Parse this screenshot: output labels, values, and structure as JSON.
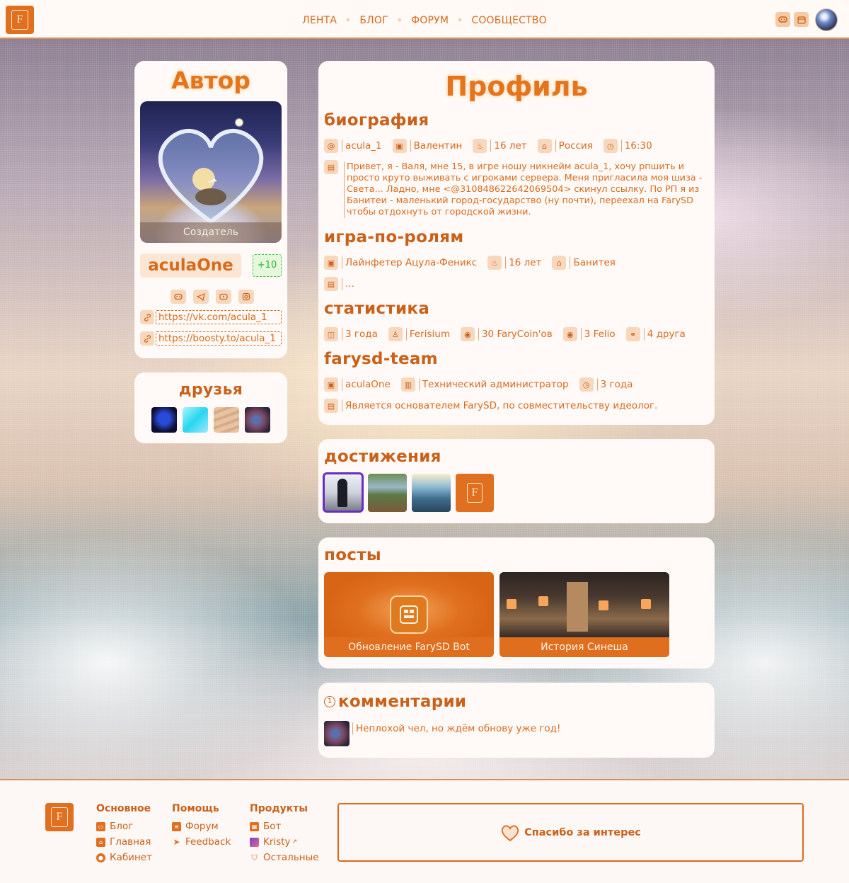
{
  "header": {
    "nav": [
      "ЛЕНТА",
      "БЛОГ",
      "ФОРУМ",
      "СООБЩЕСТВО"
    ]
  },
  "author": {
    "title": "Автор",
    "role": "Создатель",
    "username": "aculaOne",
    "rating": "+10",
    "links": [
      "https://vk.com/acula_1",
      "https://boosty.to/acula_1"
    ]
  },
  "friends": {
    "title": "друзья"
  },
  "profile": {
    "title": "Профиль",
    "bio": {
      "title": "биография",
      "nickname": "acula_1",
      "name": "Валентин",
      "age": "16 лет",
      "country": "Россия",
      "time": "16:30",
      "text": "Привет, я - Валя, мне 15, в игре ношу никнейм acula_1, хочу рпшить и просто круто выживать с игроками сервера. Меня пригласила моя шиза - Света... Ладно, мне <@310848622642069504> скинул ссылку. По РП я из Банитеи - маленький город-государство (ну почти), переехал на FarySD чтобы отдохнуть от городской жизни."
    },
    "rp": {
      "title": "игра-по-ролям",
      "character": "Лайнфетер Ацула-Феникс",
      "age": "16 лет",
      "origin": "Банитея",
      "note": "..."
    },
    "stats": {
      "title": "статистика",
      "playtime": "3 года",
      "server": "Ferisium",
      "coins": "30 FaryCoin'ов",
      "felio": "3 Felio",
      "friends": "4 друга"
    },
    "team": {
      "title": "farysd-team",
      "nick": "aculaOne",
      "position": "Технический администратор",
      "tenure": "3 года",
      "note": "Является основателем FarySD, по совместительству идеолог."
    }
  },
  "achievements": {
    "title": "достижения"
  },
  "posts": {
    "title": "посты",
    "items": [
      {
        "title": "Обновление FarySD Bot"
      },
      {
        "title": "История Синеша"
      }
    ]
  },
  "comments": {
    "count": "1",
    "title": "комментарии",
    "items": [
      {
        "text": "Неплохой чел, но ждём обнову уже год!"
      }
    ]
  },
  "footer": {
    "logo": "F",
    "cols": [
      {
        "title": "Основное",
        "links": [
          "Блог",
          "Главная",
          "Кабинет"
        ]
      },
      {
        "title": "Помощь",
        "links": [
          "Форум",
          "Feedback"
        ]
      },
      {
        "title": "Продукты",
        "links": [
          "Бот",
          "Kristy",
          "Остальные"
        ]
      }
    ],
    "thanks": "Спасибо за интерес"
  },
  "colors": {
    "accent": "#e07020",
    "text": "#d86a1c",
    "card": "#fffaf7",
    "rating_green": "#3cc43c"
  },
  "icons": {
    "logo": "farysd-logo-icon",
    "header_buttons": [
      "discord-icon",
      "calendar-icon"
    ],
    "socials": [
      "discord-icon",
      "telegram-icon",
      "youtube-icon",
      "instagram-icon"
    ]
  }
}
